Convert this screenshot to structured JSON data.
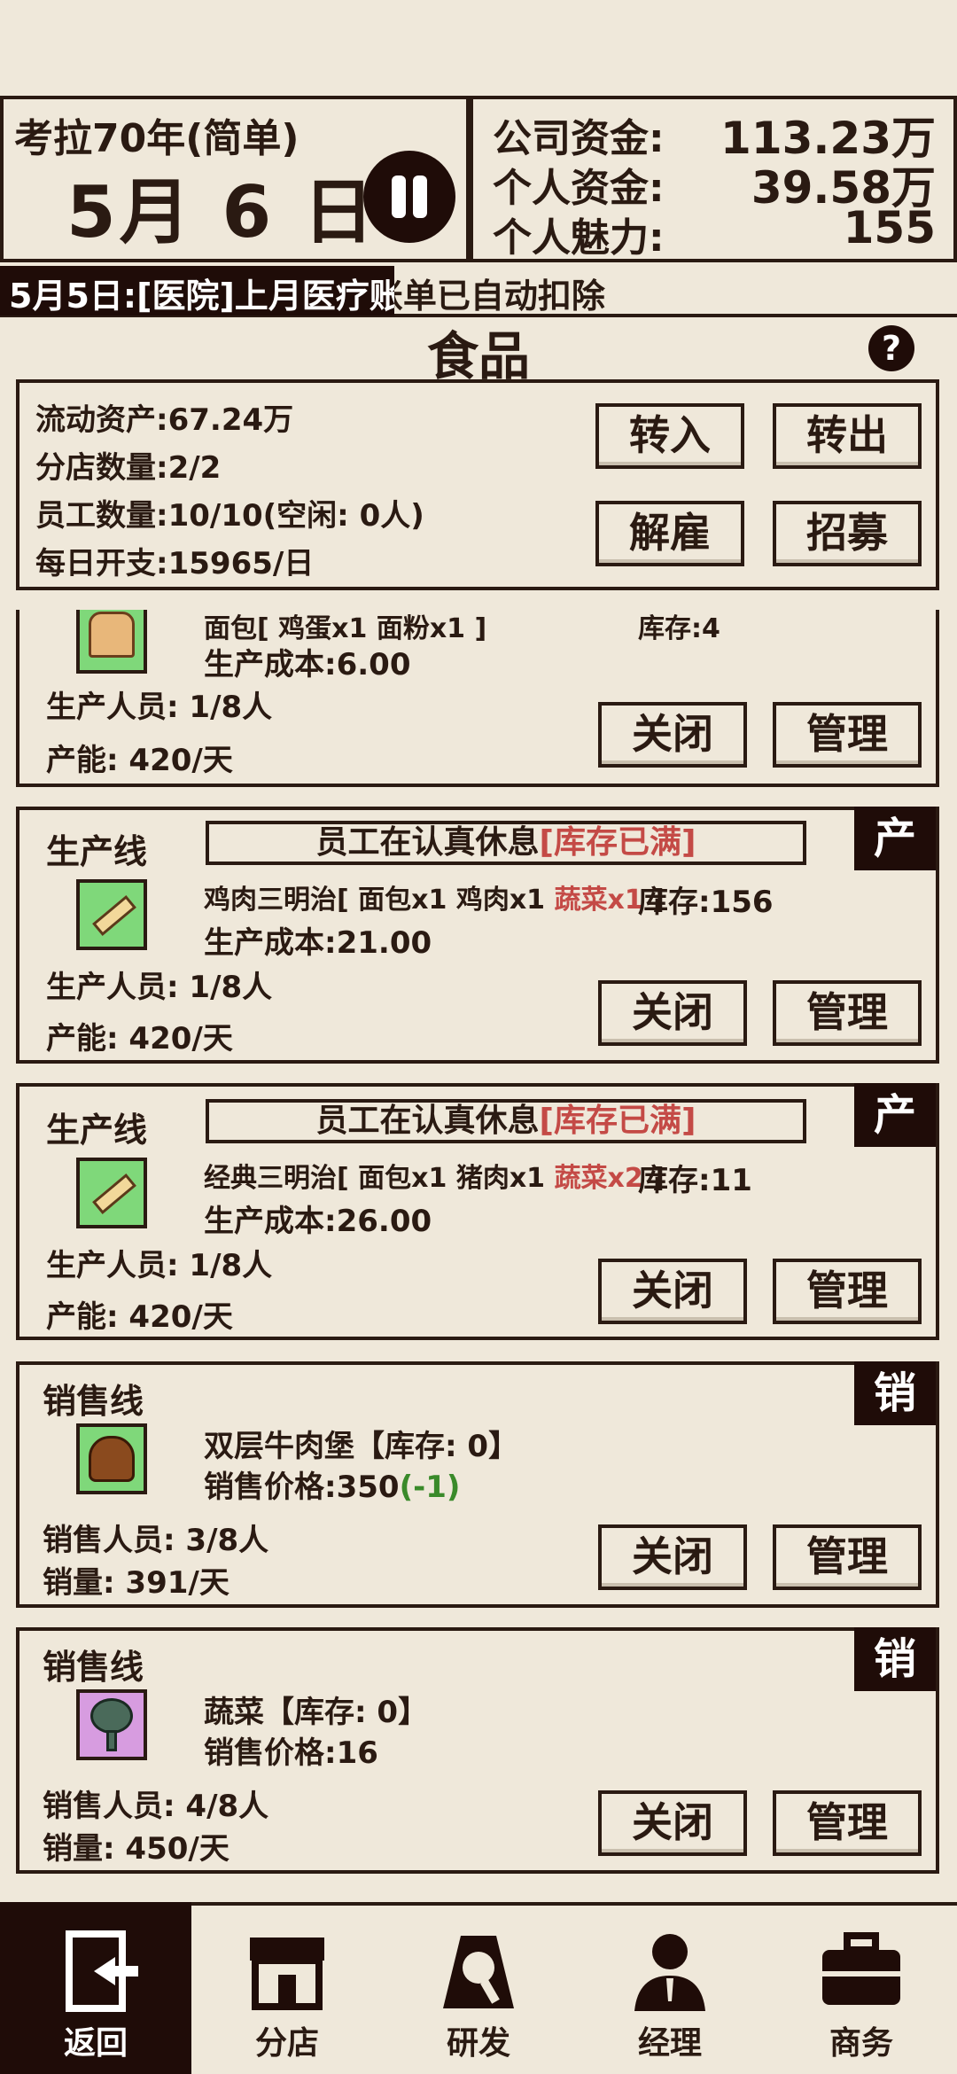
{
  "top": {
    "save_name": "考拉70年(简单)",
    "date": "5月 6 日",
    "company_funds_label": "公司资金:",
    "company_funds_value": "113.23万",
    "personal_funds_label": "个人资金:",
    "personal_funds_value": "39.58万",
    "charm_label": "个人魅力:",
    "charm_value": "155"
  },
  "news": "5月5日:[医院]上月医疗账单已自动扣除",
  "section_title": "食品",
  "summary": {
    "liquid_assets": "流动资产:67.24万",
    "branches": "分店数量:2/2",
    "employees": "员工数量:10/10(空闲: 0人)",
    "daily_cost": "每日开支:15965/日",
    "btn_transfer_in": "转入",
    "btn_transfer_out": "转出",
    "btn_fire": "解雇",
    "btn_recruit": "招募"
  },
  "cards": {
    "c0": {
      "recipe": "面包[ 鸡蛋x1  面粉x1 ]",
      "stock": "库存:4",
      "cost": "生产成本:6.00",
      "staff": "生产人员: 1/8人",
      "capacity": "产能: 420/天",
      "close": "关闭",
      "manage": "管理"
    },
    "c1": {
      "title": "生产线",
      "status_normal": "员工在认真休息",
      "status_red": "[库存已满]",
      "tag": "产",
      "recipe_a": "鸡肉三明治[ 面包x1  鸡肉x1 ",
      "recipe_red": "蔬菜x1",
      "recipe_b": " ]",
      "stock": "库存:156",
      "cost": "生产成本:21.00",
      "staff": "生产人员: 1/8人",
      "capacity": "产能: 420/天",
      "close": "关闭",
      "manage": "管理"
    },
    "c2": {
      "title": "生产线",
      "status_normal": "员工在认真休息",
      "status_red": "[库存已满]",
      "tag": "产",
      "recipe_a": "经典三明治[ 面包x1  猪肉x1 ",
      "recipe_red": "蔬菜x2",
      "recipe_b": " ]",
      "stock": "库存:11",
      "cost": "生产成本:26.00",
      "staff": "生产人员: 1/8人",
      "capacity": "产能: 420/天",
      "close": "关闭",
      "manage": "管理"
    },
    "c3": {
      "title": "销售线",
      "tag": "销",
      "product": "双层牛肉堡【库存: 0】",
      "price": "销售价格:350",
      "price_change": "(-1)",
      "staff": "销售人员: 3/8人",
      "sales": "销量: 391/天",
      "close": "关闭",
      "manage": "管理"
    },
    "c4": {
      "title": "销售线",
      "tag": "销",
      "product": "蔬菜【库存: 0】",
      "price": "销售价格:16",
      "staff": "销售人员: 4/8人",
      "sales": "销量: 450/天",
      "close": "关闭",
      "manage": "管理"
    }
  },
  "nav": [
    "返回",
    "分店",
    "研发",
    "经理",
    "商务"
  ],
  "colors": {
    "dark": "#1f0c08",
    "bg": "#efe8da",
    "red": "#c44a46",
    "green": "#3a8a2a"
  }
}
